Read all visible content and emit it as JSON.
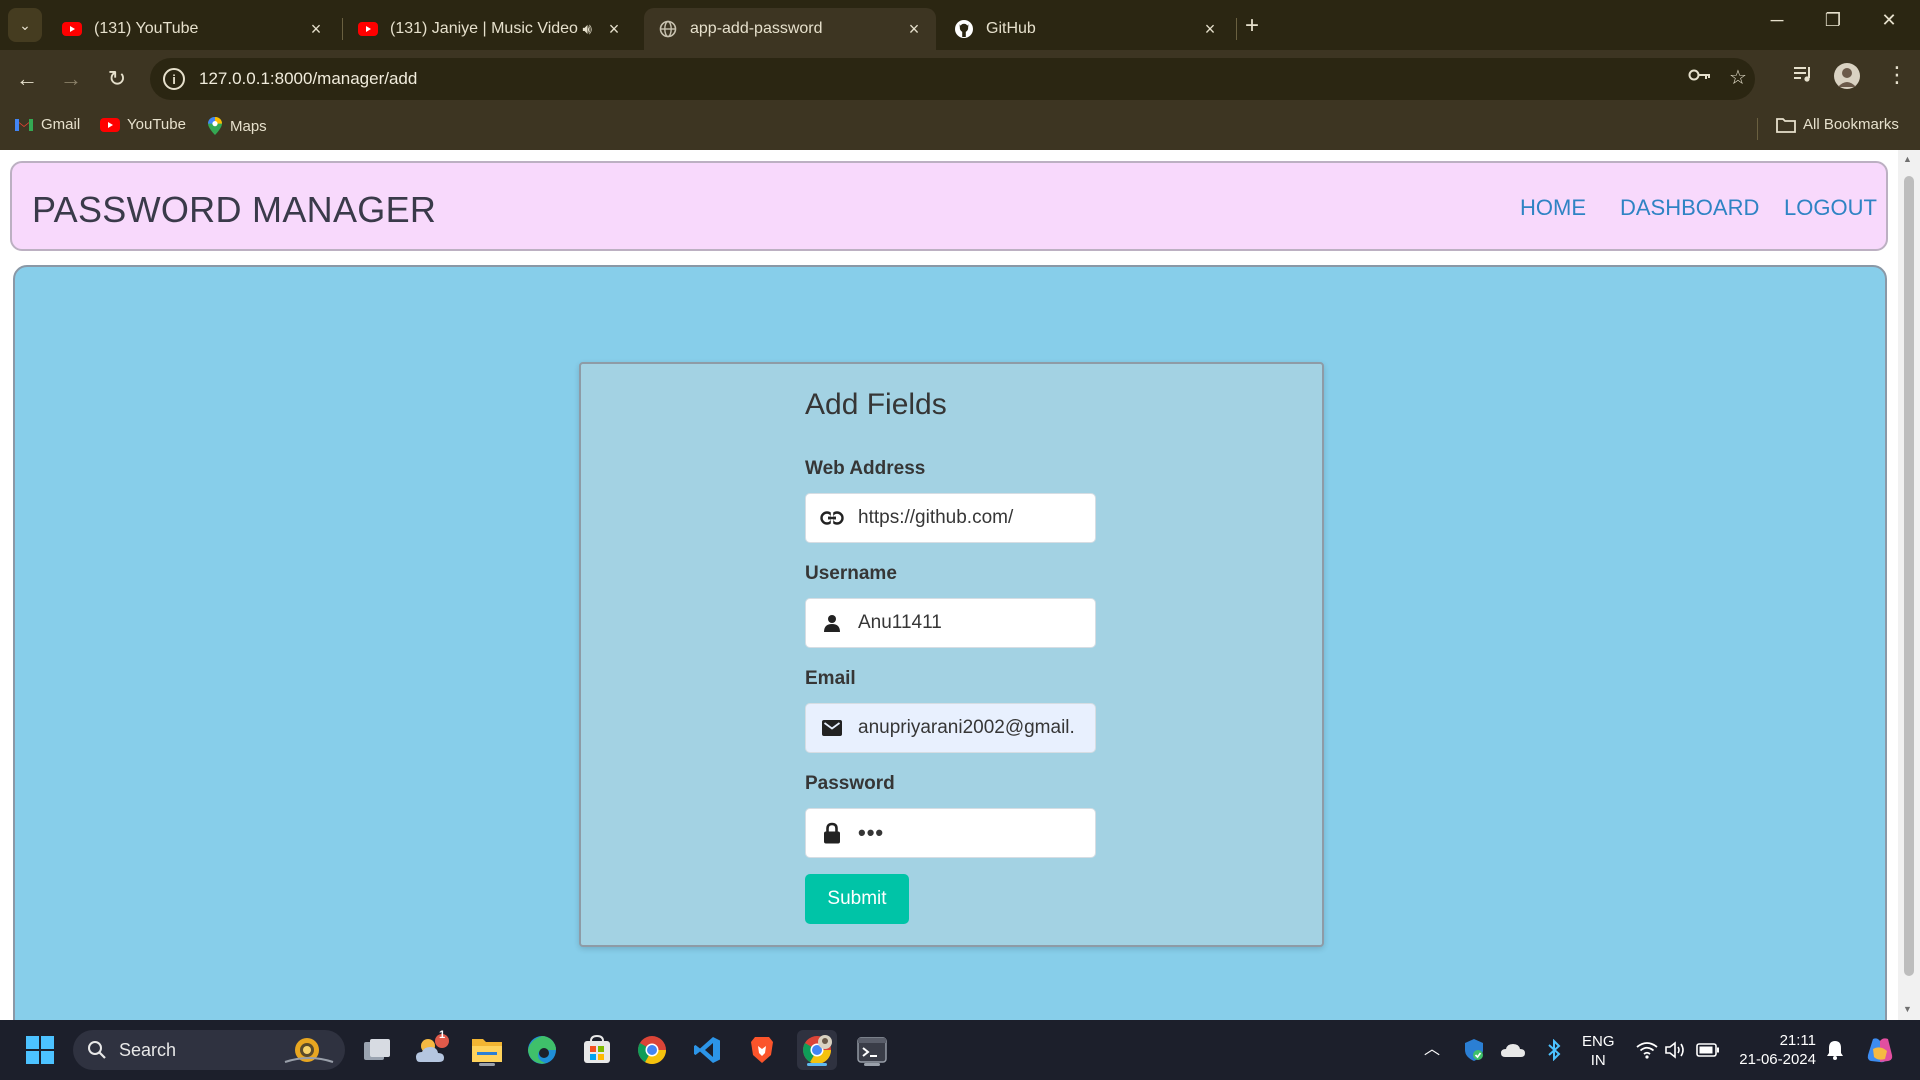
{
  "browser": {
    "tabs": [
      {
        "title": "(131) YouTube",
        "favicon": "youtube-icon",
        "active": false
      },
      {
        "title": "(131) Janiye | Music Video |",
        "favicon": "youtube-icon",
        "active": false
      },
      {
        "title": "app-add-password",
        "favicon": "globe-icon",
        "active": true
      },
      {
        "title": "GitHub",
        "favicon": "github-icon",
        "active": false
      }
    ],
    "url": "127.0.0.1:8000/manager/add",
    "bookmarks": [
      {
        "label": "Gmail",
        "icon": "gmail-icon"
      },
      {
        "label": "YouTube",
        "icon": "youtube-icon"
      },
      {
        "label": "Maps",
        "icon": "maps-icon"
      }
    ],
    "all_bookmarks": "All Bookmarks"
  },
  "navbar": {
    "brand": "PASSWORD MANAGER",
    "links": [
      "HOME",
      "DASHBOARD",
      "LOGOUT"
    ]
  },
  "form": {
    "title": "Add Fields",
    "fields": [
      {
        "label": "Web Address",
        "value": "https://github.com/",
        "icon": "link-icon"
      },
      {
        "label": "Username",
        "value": "Anu11411",
        "icon": "user-icon"
      },
      {
        "label": "Email",
        "value": "anupriyarani2002@gmail.",
        "icon": "envelope-icon"
      },
      {
        "label": "Password",
        "value": "•••",
        "icon": "lock-icon"
      }
    ],
    "submit": "Submit"
  },
  "taskbar": {
    "search": "Search",
    "weather_badge": "1",
    "language": "ENG",
    "region": "IN",
    "time": "21:11",
    "date": "21-06-2024"
  },
  "colors": {
    "navbar_bg": "#f8d9fc",
    "main_bg": "#87ceea",
    "card_bg": "#a3d2e3",
    "submit_bg": "#00c4a7",
    "link_color": "#2f83c4"
  }
}
